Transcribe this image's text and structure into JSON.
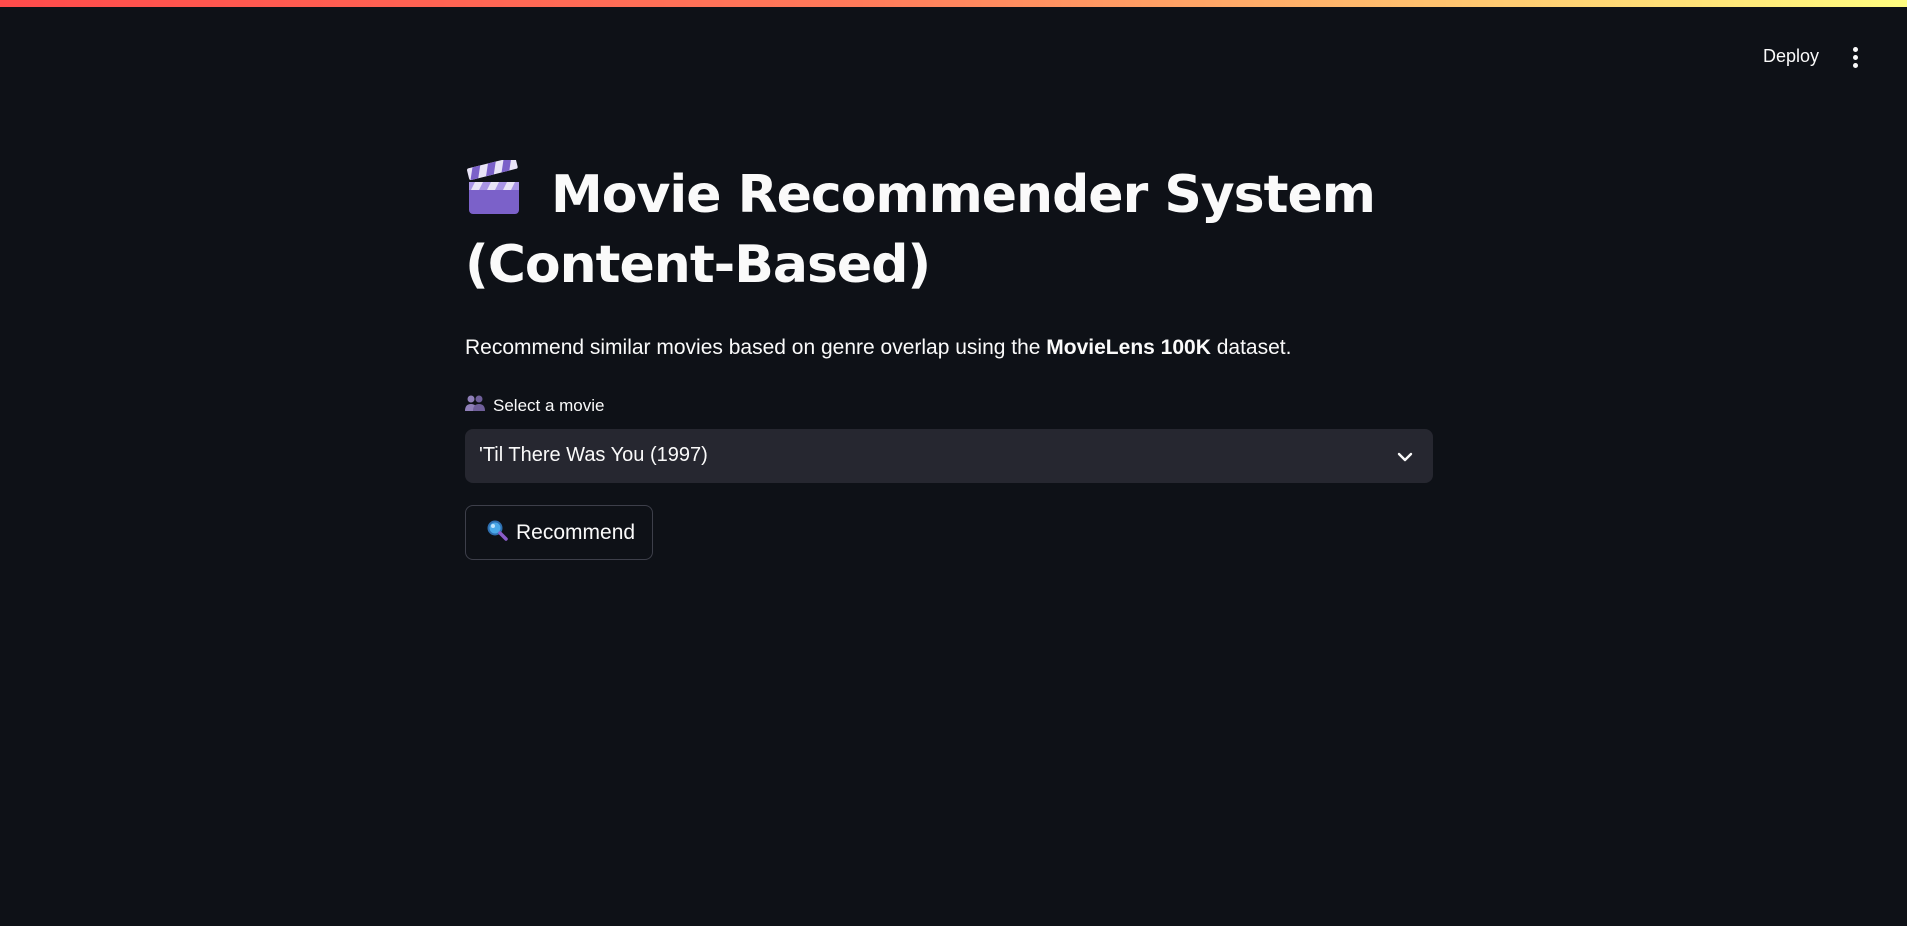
{
  "header": {
    "deploy_label": "Deploy",
    "menu_icon": "more-vertical-icon"
  },
  "main": {
    "title_icon": "clapper-board-icon",
    "title": "Movie Recommender System (Content-Based)",
    "subtitle_prefix": "Recommend similar movies based on genre overlap using the ",
    "subtitle_bold": "MovieLens 100K",
    "subtitle_suffix": " dataset.",
    "select_label_icon": "people-icon",
    "select_label": "Select a movie",
    "selected_movie": "'Til There Was You (1997)",
    "recommend_icon": "magnifier-icon",
    "recommend_label": "Recommend"
  },
  "colors": {
    "background": "#0e1117",
    "select_background": "#262730",
    "text": "#fafafa",
    "accent_gradient_start": "#ff4b4b",
    "accent_gradient_end": "#fffd80"
  }
}
